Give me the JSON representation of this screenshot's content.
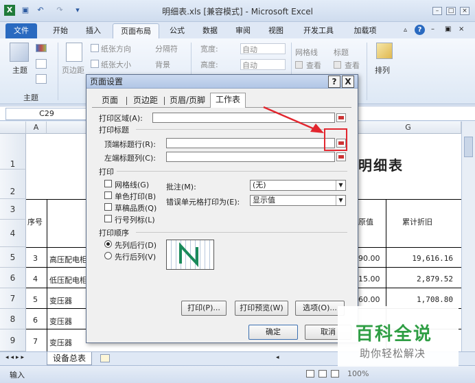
{
  "window": {
    "title": "明细表.xls  [兼容模式] - Microsoft Excel"
  },
  "tabs": [
    "文件",
    "开始",
    "插入",
    "页面布局",
    "公式",
    "数据",
    "审阅",
    "视图",
    "开发工具",
    "加载项"
  ],
  "ribbon": {
    "theme_label": "主题",
    "theme_group": "主题",
    "margins_label": "页边距",
    "orientation": "纸张方向",
    "size": "纸张大小",
    "breaks": "分隔符",
    "background": "背景",
    "width_label": "宽度:",
    "height_label": "高度:",
    "auto1": "自动",
    "auto2": "自动",
    "gridlines": "网格线",
    "headings": "标题",
    "view1": "查看",
    "view2": "查看",
    "arrange": "排列"
  },
  "namebox": "C29",
  "columns": [
    "A",
    "G"
  ],
  "rows": [
    "1",
    "2",
    "3",
    "4",
    "5",
    "6",
    "7",
    "8",
    "9"
  ],
  "sheet": {
    "title_fragment": "明细表",
    "header_seq": "序号",
    "header_value": "原值",
    "header_depr": "累计折旧",
    "data": [
      {
        "seq": "3",
        "name": "高压配电柜",
        "val": "90.00",
        "depr": "19,616.16"
      },
      {
        "seq": "4",
        "name": "低压配电柜",
        "val": "15.00",
        "depr": "2,879.52"
      },
      {
        "seq": "5",
        "name": "变压器",
        "val": "60.00",
        "depr": "1,708.80"
      },
      {
        "seq": "6",
        "name": "变压器",
        "val": "",
        "depr": ""
      },
      {
        "seq": "7",
        "name": "变压器",
        "val": "",
        "depr": ""
      }
    ]
  },
  "sheettabs": {
    "tab1": "设备总表"
  },
  "status": {
    "mode": "输入",
    "zoom": "100%"
  },
  "dialog": {
    "title": "页面设置",
    "help": "?",
    "close": "X",
    "tabs": [
      "页面",
      "页边距",
      "页眉/页脚",
      "工作表"
    ],
    "print_area": "打印区域(A):",
    "print_titles": "打印标题",
    "rows_repeat": "顶端标题行(R):",
    "cols_repeat": "左端标题列(C):",
    "print_section": "打印",
    "gridlines": "网格线(G)",
    "mono": "单色打印(B)",
    "draft": "草稿品质(Q)",
    "rowcol": "行号列标(L)",
    "comments_label": "批注(M):",
    "comments_value": "(无)",
    "errors_label": "错误单元格打印为(E):",
    "errors_value": "显示值",
    "order_section": "打印顺序",
    "down_over": "先列后行(D)",
    "over_down": "先行后列(V)",
    "print_btn": "打印(P)...",
    "preview_btn": "打印预览(W)",
    "options_btn": "选项(O)...",
    "ok_btn": "确定",
    "cancel_btn": "取消"
  },
  "watermark": {
    "brand": "百科全说",
    "tagline": "助你轻松解决"
  },
  "colors": {
    "accent": "#2a6ac0",
    "highlight": "#e2262e",
    "watermark_green": "#2f9e44"
  }
}
